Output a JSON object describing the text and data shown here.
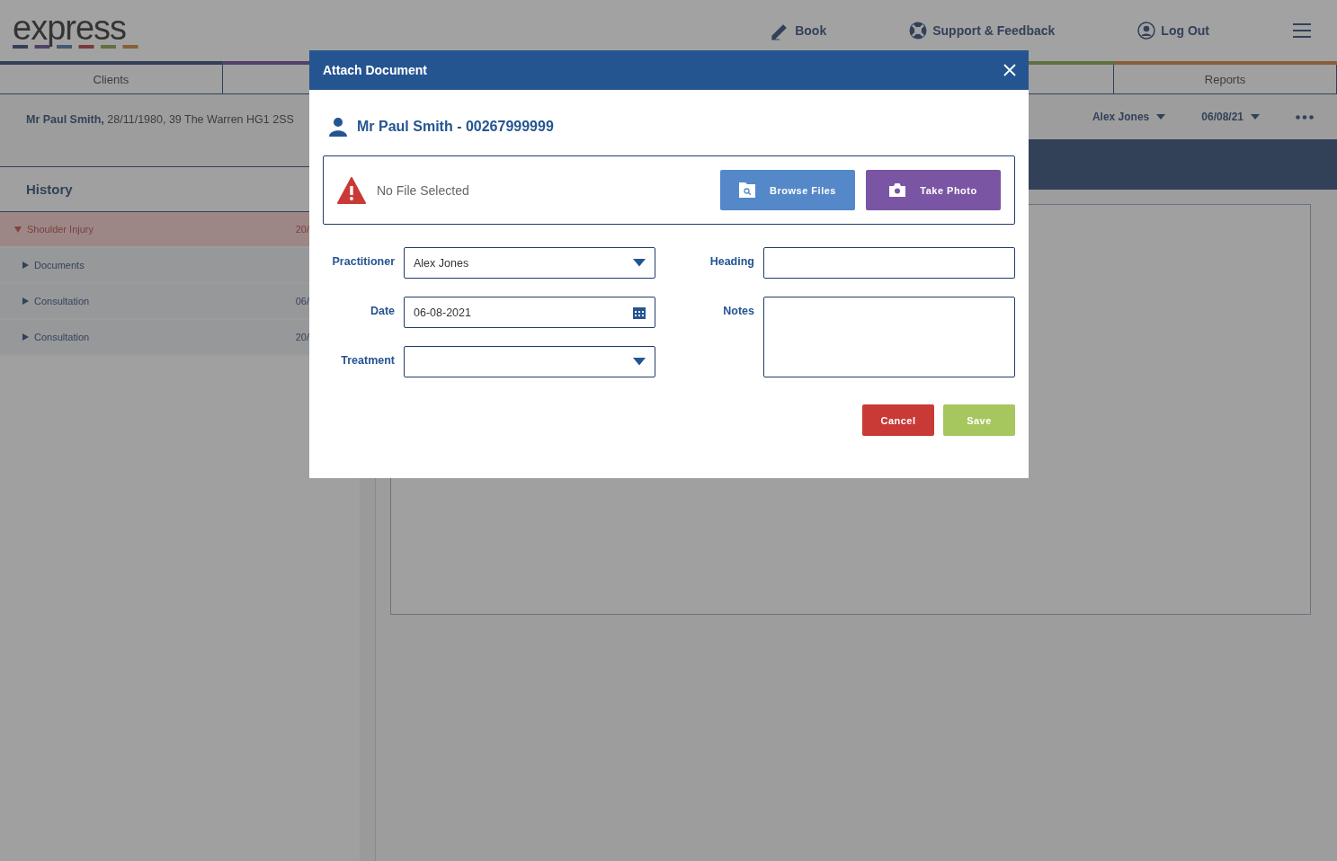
{
  "header": {
    "logo": "express",
    "nav": [
      {
        "label": "Book",
        "kind": "pen"
      },
      {
        "label": "Support & Feedback",
        "kind": "lifebuoy"
      },
      {
        "label": "Log Out",
        "kind": "user"
      }
    ]
  },
  "tabs": [
    {
      "label": "Clients"
    },
    {
      "label": "Reports"
    }
  ],
  "client_bar": {
    "summary": "**Mr Paul Smith,** 28/11/1980, 39 The Warren HG1 2SS",
    "practitioner": "Alex Jones",
    "date": "06/08/21"
  },
  "history": {
    "title": "History",
    "items": [
      {
        "label": "Shoulder Injury",
        "date": "20/",
        "expanded": true,
        "selected": true,
        "children": [
          {
            "label": "Documents",
            "expanded": false,
            "selected": false
          },
          {
            "label": "Consultation",
            "date": "06/",
            "expanded": false,
            "selected": false
          },
          {
            "label": "Consultation",
            "date": "20/",
            "expanded": false,
            "selected": false
          }
        ]
      }
    ]
  },
  "dialog": {
    "title": "Attach Document",
    "client": "Mr Paul Smith - 00267999999",
    "file_status": "No File Selected",
    "file_buttons": [
      {
        "label": "Browse Files",
        "kind": "browse"
      },
      {
        "label": "Take Photo",
        "kind": "photo"
      }
    ],
    "left_fields": [
      {
        "label": "Practitioner",
        "kind": "select",
        "value": "Alex Jones"
      },
      {
        "label": "Date",
        "kind": "date",
        "value": "06-08-2021"
      },
      {
        "label": "Treatment",
        "kind": "select"
      }
    ],
    "right_fields": [
      {
        "label": "Heading",
        "kind": "text"
      },
      {
        "label": "Notes",
        "kind": "textarea"
      }
    ],
    "buttons": [
      {
        "label": "Cancel",
        "kind": "cancel"
      },
      {
        "label": "Save",
        "kind": "save"
      }
    ]
  }
}
